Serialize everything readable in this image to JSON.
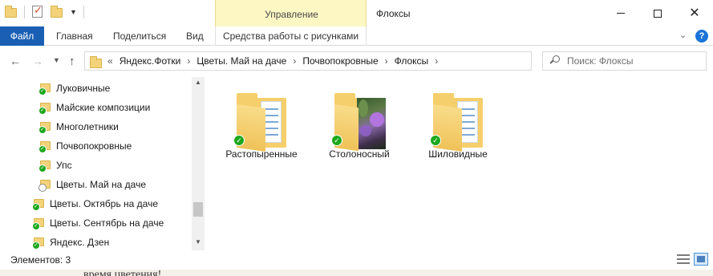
{
  "window": {
    "title": "Флоксы",
    "contextual_group": "Управление"
  },
  "ribbon": {
    "file": "Файл",
    "home": "Главная",
    "share": "Поделиться",
    "view": "Вид",
    "picture_tools": "Средства работы с рисунками"
  },
  "address": {
    "overflow": "«",
    "crumbs": [
      "Яндекс.Фотки",
      "Цветы. Май на даче",
      "Почвопокровные",
      "Флоксы"
    ]
  },
  "search": {
    "placeholder": "Поиск: Флоксы"
  },
  "nav_tree": [
    {
      "label": "Луковичные",
      "status": "synced"
    },
    {
      "label": "Майские композиции",
      "status": "synced"
    },
    {
      "label": "Многолетники",
      "status": "synced"
    },
    {
      "label": "Почвопокровные",
      "status": "synced"
    },
    {
      "label": "Упс",
      "status": "synced"
    },
    {
      "label": "Цветы. Май на даче",
      "status": "syncing"
    },
    {
      "label": "Цветы. Октябрь на даче",
      "status": "synced"
    },
    {
      "label": "Цветы. Сентябрь на даче",
      "status": "synced"
    },
    {
      "label": "Яндекс. Дзен",
      "status": "synced"
    }
  ],
  "folders": [
    {
      "label": "Растопыренные",
      "thumbnail": "documents",
      "status": "synced"
    },
    {
      "label": "Столоносный",
      "thumbnail": "photo",
      "status": "synced"
    },
    {
      "label": "Шиловидные",
      "thumbnail": "documents",
      "status": "synced"
    }
  ],
  "status": {
    "items": "Элементов: 3"
  },
  "background_text": "время цветения!",
  "colors": {
    "file_tab": "#1a5fb4",
    "manage_tab": "#fdf7c4",
    "sync_ok": "#1da81d",
    "folder": "#f5cf6b"
  }
}
